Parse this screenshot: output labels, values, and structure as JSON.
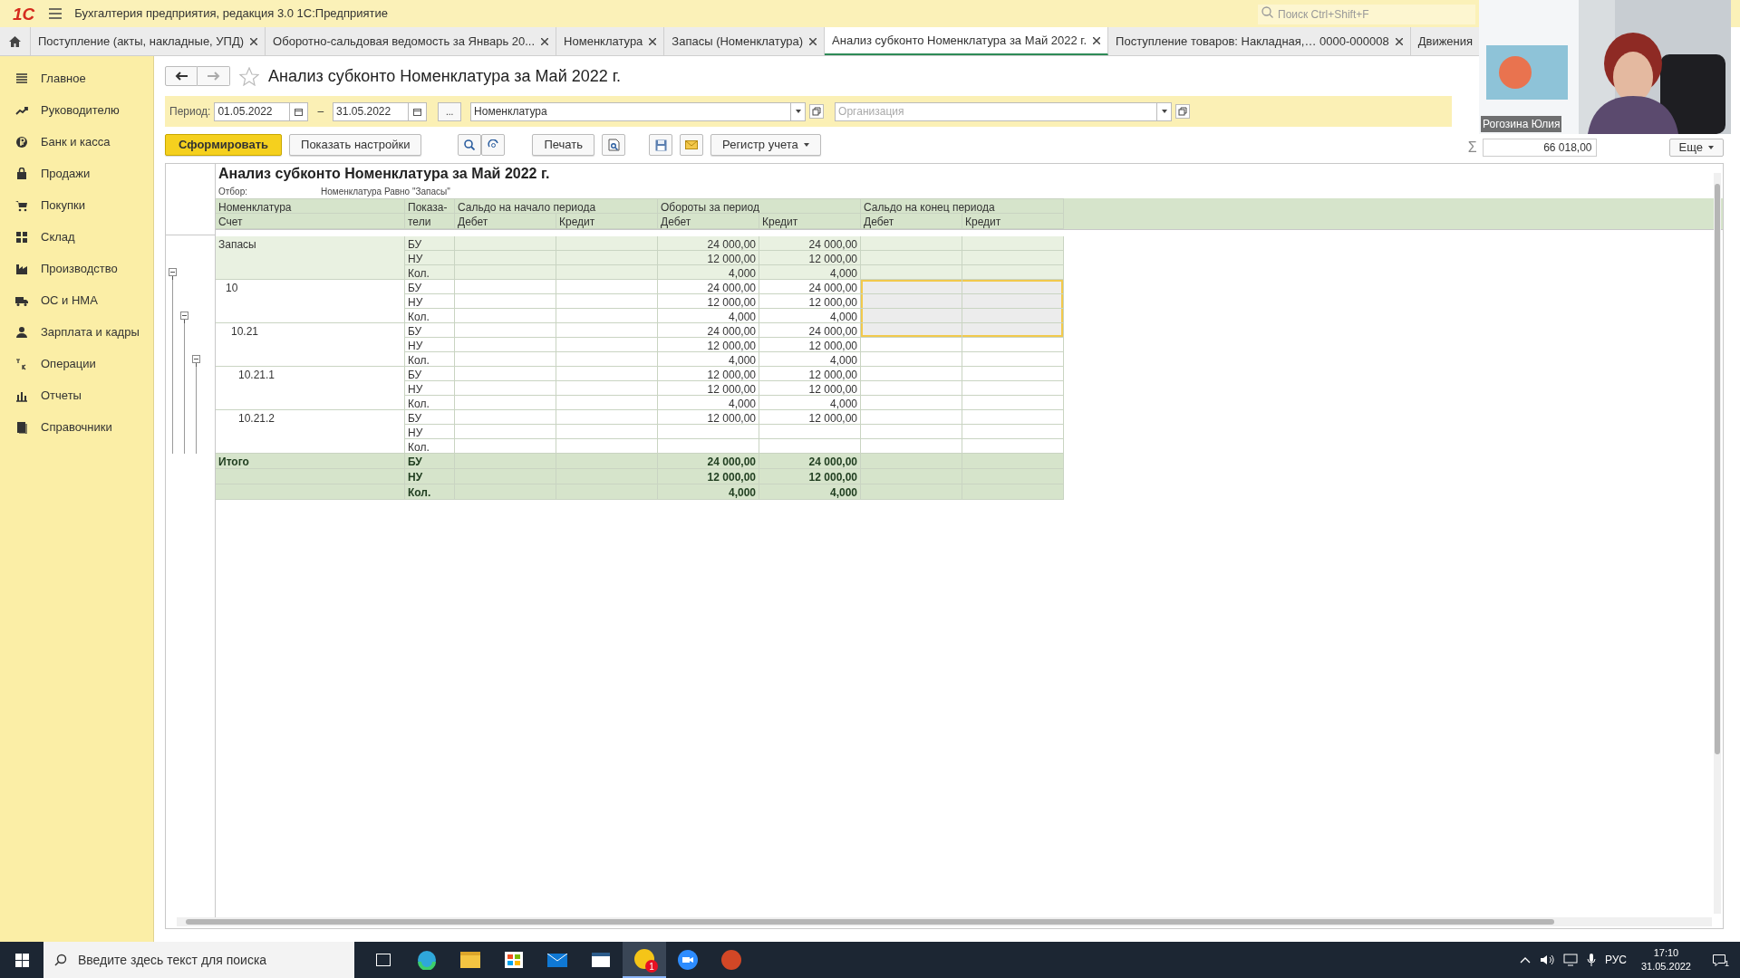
{
  "app": {
    "logo": "1С",
    "title": "Бухгалтерия предприятия, редакция 3.0 1С:Предприятие",
    "search_placeholder": "Поиск Ctrl+Shift+F"
  },
  "tabs": [
    {
      "label": "Поступление (акты, накладные, УПД)",
      "selected": false,
      "closable": true
    },
    {
      "label": "Оборотно-сальдовая ведомость за Январь 20...",
      "selected": false,
      "closable": true
    },
    {
      "label": "Номенклатура",
      "selected": false,
      "closable": true
    },
    {
      "label": "Запасы (Номенклатура)",
      "selected": false,
      "closable": true
    },
    {
      "label": "Анализ субконто Номенклатура за Май 2022 г.",
      "selected": true,
      "closable": true
    },
    {
      "label": "Поступление товаров: Накладная,… 0000-000008",
      "selected": false,
      "closable": true
    },
    {
      "label": "Движения",
      "selected": false,
      "closable": false
    }
  ],
  "sidebar": {
    "items": [
      {
        "label": "Главное"
      },
      {
        "label": "Руководителю"
      },
      {
        "label": "Банк и касса"
      },
      {
        "label": "Продажи"
      },
      {
        "label": "Покупки"
      },
      {
        "label": "Склад"
      },
      {
        "label": "Производство"
      },
      {
        "label": "ОС и НМА"
      },
      {
        "label": "Зарплата и кадры"
      },
      {
        "label": "Операции"
      },
      {
        "label": "Отчеты"
      },
      {
        "label": "Справочники"
      }
    ]
  },
  "form": {
    "title": "Анализ субконто Номенклатура за Май 2022 г.",
    "favorite": false
  },
  "filters": {
    "period_label": "Период:",
    "date_from": "01.05.2022",
    "dash": "–",
    "date_to": "31.05.2022",
    "more": "...",
    "nomenclature": "Номенклатура",
    "organization_placeholder": "Организация"
  },
  "toolbar": {
    "buttons": [
      {
        "label": "Сформировать",
        "kind": "primary"
      },
      {
        "label": "Показать настройки",
        "kind": "text"
      },
      {
        "label": "Печать",
        "kind": "text"
      },
      {
        "label": "Регистр учета",
        "kind": "dropdown"
      }
    ],
    "sum_sign": "Σ",
    "sum": "66 018,00",
    "more_button": "Еще"
  },
  "report": {
    "title": "Анализ субконто Номенклатура за Май 2022 г.",
    "filter_label": "Отбор:",
    "filter_value": "Номенклатура Равно \"Запасы\"",
    "header_top": [
      "Номенклатура",
      "Показа-",
      "Сальдо на начало периода",
      "Обороты за период",
      "Сальдо на конец периода"
    ],
    "header_bottom": [
      "Счет",
      "тели",
      "Дебет",
      "Кредит",
      "Дебет",
      "Кредит",
      "Дебет",
      "Кредит"
    ],
    "tree": [
      {
        "name": "Запасы",
        "expanded": true,
        "lines": [
          {
            "indicator": "БУ",
            "turnover_debit": "24 000,00",
            "turnover_credit": "24 000,00",
            "selected": false
          },
          {
            "indicator": "НУ",
            "turnover_debit": "12 000,00",
            "turnover_credit": "12 000,00",
            "selected": false
          },
          {
            "indicator": "Кол.",
            "turnover_debit": "4,000",
            "turnover_credit": "4,000",
            "selected": false
          }
        ],
        "children": [
          {
            "name": "10",
            "expanded": true,
            "lines": [
              {
                "indicator": "БУ",
                "turnover_debit": "24 000,00",
                "turnover_credit": "24 000,00",
                "selected": true
              },
              {
                "indicator": "НУ",
                "turnover_debit": "12 000,00",
                "turnover_credit": "12 000,00",
                "selected": true
              },
              {
                "indicator": "Кол.",
                "turnover_debit": "4,000",
                "turnover_credit": "4,000",
                "selected": true
              }
            ],
            "children": [
              {
                "name": "10.21",
                "expanded": true,
                "lines": [
                  {
                    "indicator": "БУ",
                    "turnover_debit": "24 000,00",
                    "turnover_credit": "24 000,00",
                    "selected": true
                  },
                  {
                    "indicator": "НУ",
                    "turnover_debit": "12 000,00",
                    "turnover_credit": "12 000,00",
                    "selected": false
                  },
                  {
                    "indicator": "Кол.",
                    "turnover_debit": "4,000",
                    "turnover_credit": "4,000",
                    "selected": false
                  }
                ],
                "children": [
                  {
                    "name": "10.21.1",
                    "lines": [
                      {
                        "indicator": "БУ",
                        "turnover_debit": "12 000,00",
                        "turnover_credit": "12 000,00",
                        "selected": false
                      },
                      {
                        "indicator": "НУ",
                        "turnover_debit": "12 000,00",
                        "turnover_credit": "12 000,00",
                        "selected": false
                      },
                      {
                        "indicator": "Кол.",
                        "turnover_debit": "4,000",
                        "turnover_credit": "4,000",
                        "selected": false
                      }
                    ]
                  },
                  {
                    "name": "10.21.2",
                    "lines": [
                      {
                        "indicator": "БУ",
                        "turnover_debit": "12 000,00",
                        "turnover_credit": "12 000,00",
                        "selected": false
                      },
                      {
                        "indicator": "НУ",
                        "selected": false
                      },
                      {
                        "indicator": "Кол.",
                        "selected": false
                      }
                    ]
                  }
                ]
              }
            ]
          }
        ]
      }
    ],
    "total": {
      "name": "Итого",
      "lines": [
        {
          "indicator": "БУ",
          "turnover_debit": "24 000,00",
          "turnover_credit": "24 000,00"
        },
        {
          "indicator": "НУ",
          "turnover_debit": "12 000,00",
          "turnover_credit": "12 000,00"
        },
        {
          "indicator": "Кол.",
          "turnover_debit": "4,000",
          "turnover_credit": "4,000"
        }
      ]
    }
  },
  "webcam": {
    "caption": "Рогозина Юлия"
  },
  "taskbar": {
    "search_placeholder": "Введите здесь текст для поиска",
    "badge": "1",
    "language": "РУС",
    "time": "17:10",
    "date": "31.05.2022",
    "notifications": "1"
  }
}
